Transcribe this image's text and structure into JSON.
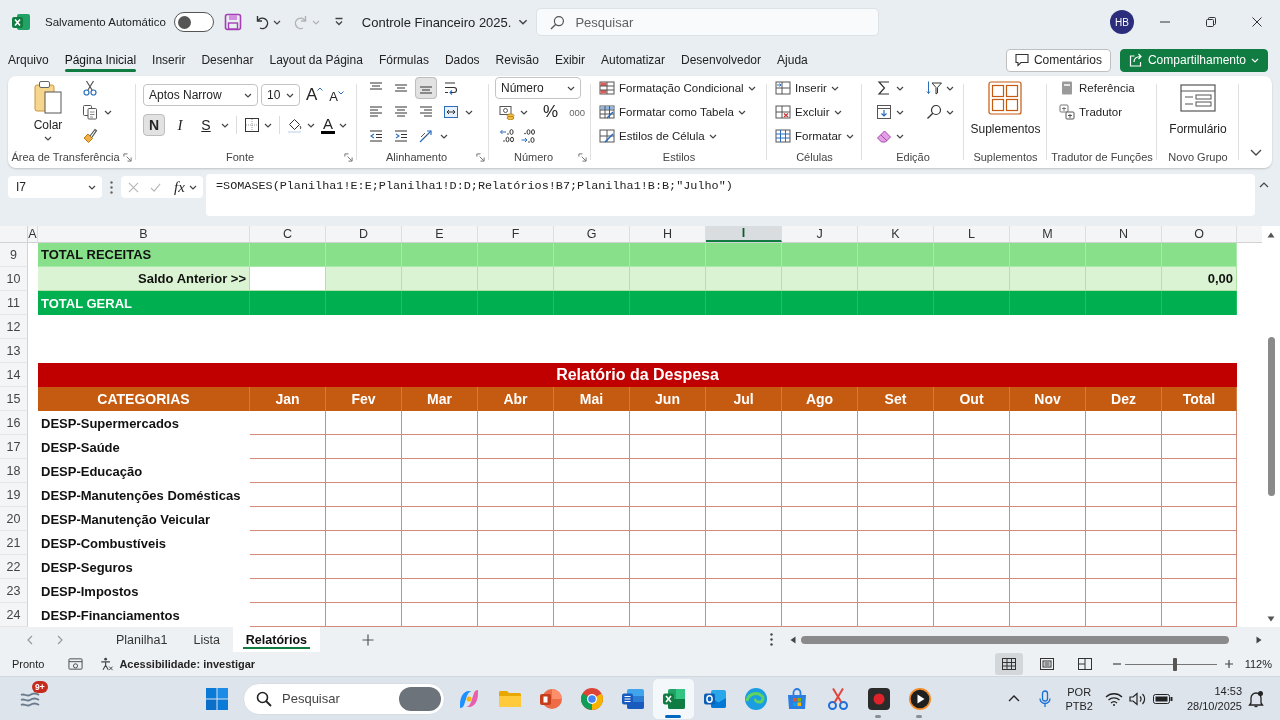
{
  "title_bar": {
    "autosave_label": "Salvamento Automático",
    "autosave_on": false,
    "document_title": "Controle Financeiro 2025.",
    "search_placeholder": "Pesquisar",
    "avatar_initials": "HB"
  },
  "ribbon_tabs": [
    {
      "label": "Arquivo",
      "selected": false
    },
    {
      "label": "Página Inicial",
      "selected": true
    },
    {
      "label": "Inserir",
      "selected": false
    },
    {
      "label": "Desenhar",
      "selected": false
    },
    {
      "label": "Layout da Página",
      "selected": false
    },
    {
      "label": "Fórmulas",
      "selected": false
    },
    {
      "label": "Dados",
      "selected": false
    },
    {
      "label": "Revisão",
      "selected": false
    },
    {
      "label": "Exibir",
      "selected": false
    },
    {
      "label": "Automatizar",
      "selected": false
    },
    {
      "label": "Desenvolvedor",
      "selected": false
    },
    {
      "label": "Ajuda",
      "selected": false
    }
  ],
  "ribbon_buttons": [
    {
      "label": "Comentários",
      "kind": "outline"
    },
    {
      "label": "Compartilhamento",
      "kind": "primary"
    }
  ],
  "ribbon": {
    "clipboard": {
      "paste_label": "Colar",
      "title": "Área de Transferência"
    },
    "font": {
      "font_name": "Aptos Narrow",
      "font_size": "10",
      "grow_label": "A",
      "shrink_label": "A",
      "styles": [
        {
          "label": "N",
          "kind": "bold",
          "on": true
        },
        {
          "label": "I",
          "kind": "italic",
          "on": false
        },
        {
          "label": "S",
          "kind": "underline",
          "on": false
        }
      ],
      "font_color_label": "A",
      "title": "Fonte"
    },
    "alignment": {
      "vertical": [
        {
          "selected": false
        },
        {
          "selected": false
        },
        {
          "selected": true
        }
      ],
      "title": "Alinhamento"
    },
    "number": {
      "format": "Número",
      "percent_label": "%",
      "thousands_label": "000",
      "title": "Número"
    },
    "styles": {
      "items": [
        "Formatação Condicional",
        "Formatar como Tabela",
        "Estilos de Célula"
      ],
      "title": "Estilos"
    },
    "cells": {
      "items": [
        "Inserir",
        "Excluir",
        "Formatar"
      ],
      "title": "Células"
    },
    "editing": {
      "title": "Edição"
    },
    "add_ins": {
      "label": "Suplementos",
      "title": "Suplementos"
    },
    "function_translator": {
      "items": [
        "Referência",
        "Tradutor"
      ],
      "title": "Tradutor de Funções"
    },
    "custom_group": {
      "label": "Formulário",
      "title": "Novo Grupo"
    }
  },
  "formula_bar": {
    "name_box": "I7",
    "function_label": "fx",
    "formula": "=SOMASES(Planilha1!E:E;Planilha1!D:D;Relatórios!B7;Planilha1!B:B;\"Julho\")"
  },
  "sheet": {
    "columns": [
      {
        "label": "A",
        "selected": false
      },
      {
        "label": "B",
        "selected": false
      },
      {
        "label": "C",
        "selected": false
      },
      {
        "label": "D",
        "selected": false
      },
      {
        "label": "E",
        "selected": false
      },
      {
        "label": "F",
        "selected": false
      },
      {
        "label": "G",
        "selected": false
      },
      {
        "label": "H",
        "selected": false
      },
      {
        "label": "I",
        "selected": true
      },
      {
        "label": "J",
        "selected": false
      },
      {
        "label": "K",
        "selected": false
      },
      {
        "label": "L",
        "selected": false
      },
      {
        "label": "M",
        "selected": false
      },
      {
        "label": "N",
        "selected": false
      },
      {
        "label": "O",
        "selected": false
      }
    ],
    "rows": [
      {
        "number": "9",
        "kind": "income_total",
        "label": "TOTAL RECEITAS"
      },
      {
        "number": "10",
        "kind": "prior_balance",
        "label": "Saldo Anterior >>",
        "total": "0,00"
      },
      {
        "number": "11",
        "kind": "grand_total",
        "label": "TOTAL GERAL"
      },
      {
        "number": "12",
        "kind": "blank"
      },
      {
        "number": "13",
        "kind": "blank"
      },
      {
        "number": "14",
        "kind": "report_title",
        "label": "Relatório da Despesa"
      },
      {
        "number": "15",
        "kind": "report_header",
        "label": "CATEGORIAS",
        "cells": [
          "Jan",
          "Fev",
          "Mar",
          "Abr",
          "Mai",
          "Jun",
          "Jul",
          "Ago",
          "Set",
          "Out",
          "Nov",
          "Dez",
          "Total"
        ]
      },
      {
        "number": "16",
        "kind": "category",
        "label": "DESP-Supermercados"
      },
      {
        "number": "17",
        "kind": "category",
        "label": "DESP-Saúde"
      },
      {
        "number": "18",
        "kind": "category",
        "label": "DESP-Educação"
      },
      {
        "number": "19",
        "kind": "category",
        "label": "DESP-Manutenções Domésticas"
      },
      {
        "number": "20",
        "kind": "category",
        "label": "DESP-Manutenção Veicular"
      },
      {
        "number": "21",
        "kind": "category",
        "label": "DESP-Combustíveis"
      },
      {
        "number": "22",
        "kind": "category",
        "label": "DESP-Seguros"
      },
      {
        "number": "23",
        "kind": "category",
        "label": "DESP-Impostos"
      },
      {
        "number": "24",
        "kind": "category",
        "label": "DESP-Financiamentos"
      }
    ]
  },
  "sheet_tabs": [
    {
      "label": "Planilha1",
      "selected": false
    },
    {
      "label": "Lista",
      "selected": false
    },
    {
      "label": "Relatórios",
      "selected": true
    }
  ],
  "status_bar": {
    "status": "Pronto",
    "accessibility": "Acessibilidade: investigar",
    "views": [
      {
        "selected": true
      },
      {
        "selected": false
      },
      {
        "selected": false
      }
    ],
    "zoom": {
      "level": 0.55,
      "reading": "112%"
    }
  },
  "taskbar": {
    "widgets_badge": "9+",
    "search_placeholder": "Pesquisar",
    "apps": [
      {
        "selected": false,
        "running": false
      },
      {
        "selected": false,
        "running": false
      },
      {
        "selected": false,
        "running": false
      },
      {
        "selected": false,
        "running": false
      },
      {
        "selected": false,
        "running": false
      },
      {
        "selected": true,
        "running": true
      },
      {
        "selected": false,
        "running": false
      },
      {
        "selected": false,
        "running": false
      },
      {
        "selected": false,
        "running": false
      },
      {
        "selected": false,
        "running": false
      },
      {
        "selected": false,
        "running": true
      },
      {
        "selected": false,
        "running": true
      }
    ],
    "language": "POR",
    "keyboard_layout": "PTB2",
    "time": "14:53",
    "date": "28/10/2025"
  }
}
